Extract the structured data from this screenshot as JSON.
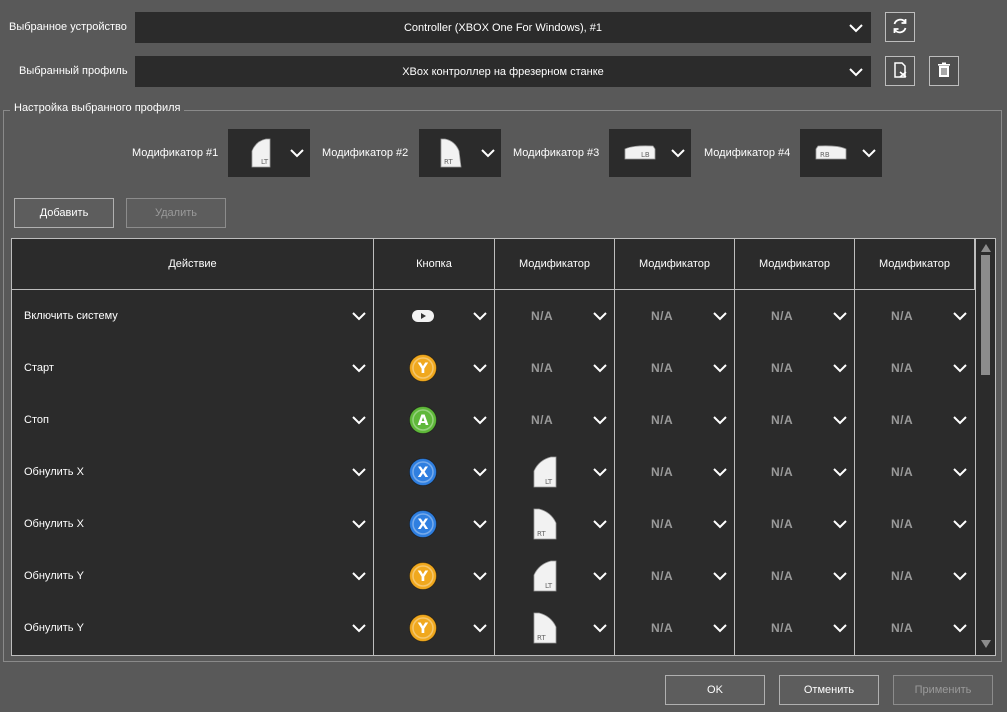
{
  "device": {
    "label": "Выбранное устройство",
    "value": "Controller (XBOX One For Windows), #1",
    "refresh_icon": "refresh-icon"
  },
  "profile": {
    "label": "Выбранный профиль",
    "value": "XBox контроллер на фрезерном станке",
    "edit_icon": "edit-profile-icon",
    "delete_icon": "trash-icon"
  },
  "group_title": "Настройка выбранного профиля",
  "modifiers": [
    {
      "label": "Модификатор #1",
      "icon": "LT"
    },
    {
      "label": "Модификатор #2",
      "icon": "RT"
    },
    {
      "label": "Модификатор #3",
      "icon": "LB"
    },
    {
      "label": "Модификатор #4",
      "icon": "RB"
    }
  ],
  "buttons": {
    "add": "Добавить",
    "remove": "Удалить",
    "ok": "OK",
    "cancel": "Отменить",
    "apply": "Применить"
  },
  "table": {
    "headers": [
      "Действие",
      "Кнопка",
      "Модификатор",
      "Модификатор",
      "Модификатор",
      "Модификатор"
    ],
    "na_text": "N/A",
    "rows": [
      {
        "action": "Включить систему",
        "button": "Start",
        "mods": [
          "N/A",
          "N/A",
          "N/A",
          "N/A"
        ]
      },
      {
        "action": "Старт",
        "button": "Y",
        "mods": [
          "N/A",
          "N/A",
          "N/A",
          "N/A"
        ]
      },
      {
        "action": "Стоп",
        "button": "A",
        "mods": [
          "N/A",
          "N/A",
          "N/A",
          "N/A"
        ]
      },
      {
        "action": "Обнулить X",
        "button": "X",
        "mods": [
          "LT",
          "N/A",
          "N/A",
          "N/A"
        ]
      },
      {
        "action": "Обнулить X",
        "button": "X",
        "mods": [
          "RT",
          "N/A",
          "N/A",
          "N/A"
        ]
      },
      {
        "action": "Обнулить Y",
        "button": "Y",
        "mods": [
          "LT",
          "N/A",
          "N/A",
          "N/A"
        ]
      },
      {
        "action": "Обнулить Y",
        "button": "Y",
        "mods": [
          "RT",
          "N/A",
          "N/A",
          "N/A"
        ]
      }
    ]
  },
  "colors": {
    "background": "#595959",
    "field": "#2b2b2b",
    "button_y": "#f0a81e",
    "button_a": "#5fb83a",
    "button_x": "#2f7fe0",
    "na": "#9a9a9a"
  }
}
